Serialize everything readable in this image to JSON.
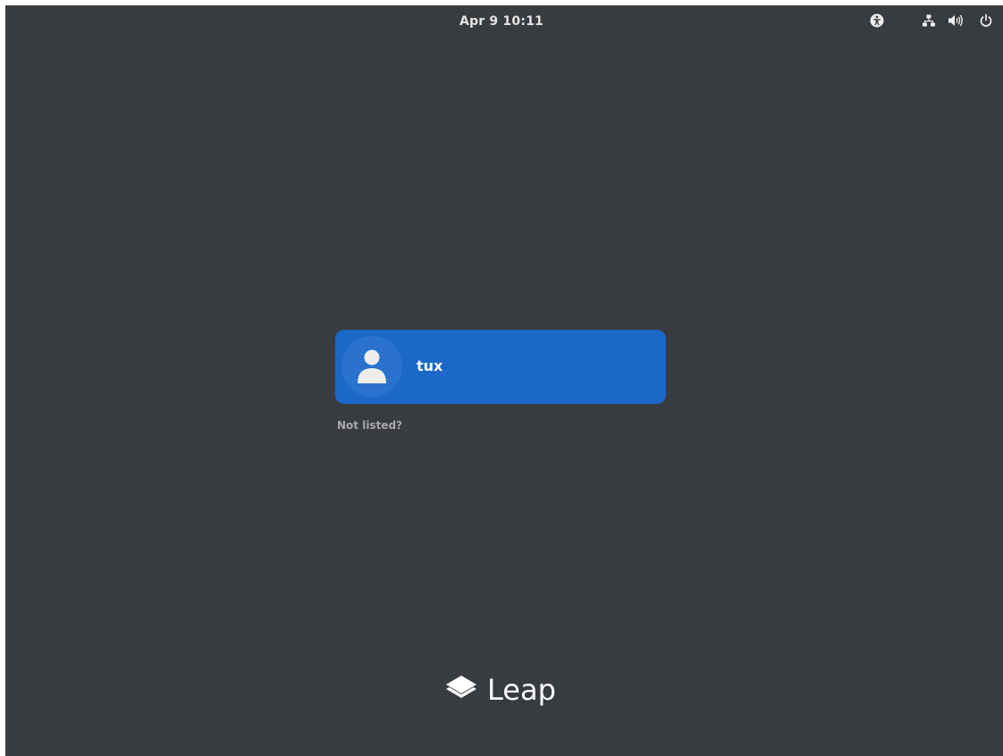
{
  "topbar": {
    "clock": "Apr 9  10:11",
    "icons": [
      "accessibility-icon",
      "network-wired-icon",
      "volume-icon",
      "power-icon"
    ]
  },
  "login": {
    "users": [
      {
        "name": "tux",
        "avatar_icon": "user-silhouette-icon"
      }
    ],
    "not_listed_label": "Not listed?"
  },
  "branding": {
    "logo_icon": "leap-logo-icon",
    "text": "Leap"
  },
  "colors": {
    "background": "#383b3f",
    "user_card": "#1c68c8",
    "foreground": "#eeeeec",
    "muted_text": "#a9a9a7"
  }
}
